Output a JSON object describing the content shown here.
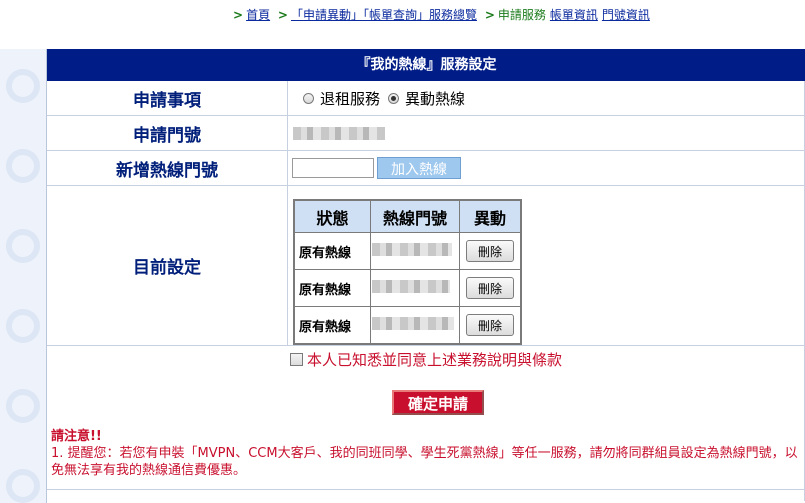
{
  "breadcrumb": {
    "items": [
      {
        "label": "首頁",
        "link": true
      },
      {
        "label": "「申請異動」「帳單查詢」服務總覽",
        "link": true
      },
      {
        "label": "申請服務",
        "link": false
      },
      {
        "label": "帳單資訊",
        "link": true
      },
      {
        "label": "門號資訊",
        "link": true
      }
    ]
  },
  "form": {
    "title": "『我的熱線』服務設定",
    "apply_item": {
      "label": "申請事項",
      "options": [
        {
          "label": "退租服務",
          "selected": false
        },
        {
          "label": "異動熱線",
          "selected": true
        }
      ]
    },
    "apply_number": {
      "label": "申請門號"
    },
    "add_hotline": {
      "label": "新增熱線門號",
      "input_value": "",
      "button": "加入熱線"
    },
    "current_setting": {
      "label": "目前設定",
      "headers": [
        "狀態",
        "熱線門號",
        "異動"
      ],
      "rows": [
        {
          "status": "原有熱線",
          "action": "刪除"
        },
        {
          "status": "原有熱線",
          "action": "刪除"
        },
        {
          "status": "原有熱線",
          "action": "刪除"
        }
      ]
    },
    "agree_text": "本人已知悉並同意上述業務說明與條款",
    "submit_label": "確定申請",
    "notice_title": "請注意!!",
    "notice_text": "1. 提醒您：若您有申裝「MVPN、CCM大客戶、我的同班同學、學生死黨熱線」等任一服務，請勿將同群組員設定為熱線門號，以免無法享有我的熱線通信費優惠。"
  },
  "colors": {
    "title_bg": "#001d87",
    "label_text": "#001f7a",
    "accent_red": "#c8102e",
    "table_header_bg": "#cfe0f4"
  }
}
